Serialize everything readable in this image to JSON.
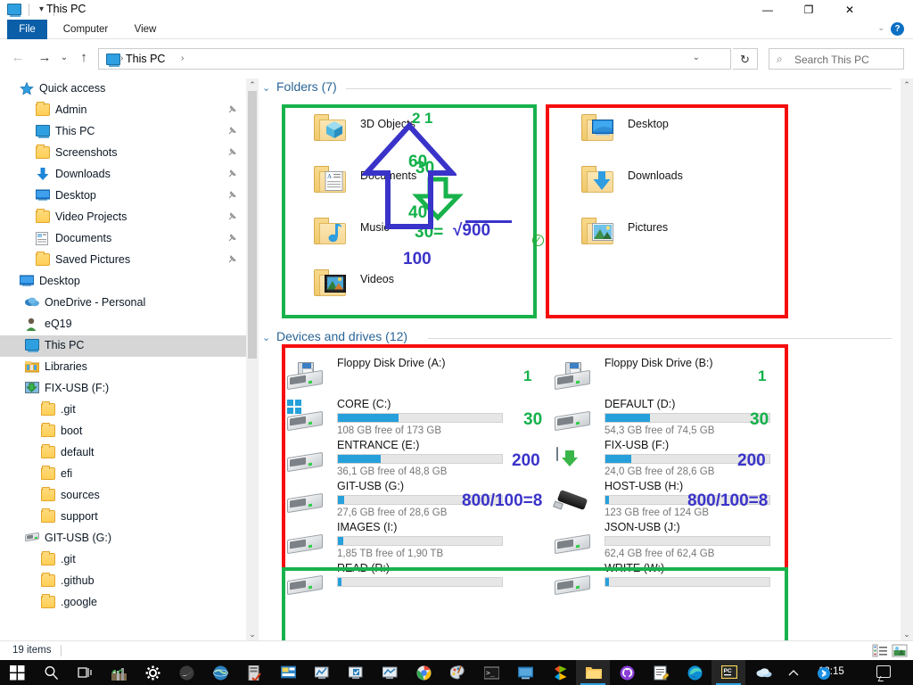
{
  "window": {
    "title": "This PC",
    "icon": "this-pc-icon",
    "quick_access_caret": "▾",
    "minimize": "—",
    "maximize": "❐",
    "close": "✕",
    "help": "?",
    "ribbon_caret": "⌄"
  },
  "ribbon": {
    "tabs": [
      {
        "label": "File"
      },
      {
        "label": "Computer"
      },
      {
        "label": "View"
      }
    ]
  },
  "address": {
    "back": "←",
    "forward": "→",
    "recent": "⌄",
    "up": "↑",
    "crumbs": [
      "This PC"
    ],
    "separator": "›",
    "dropdown_caret": "⌄",
    "refresh": "↻"
  },
  "search": {
    "placeholder": "Search This PC",
    "icon": "search-icon"
  },
  "sidebar": {
    "items": [
      {
        "label": "Quick access",
        "icon": "star-icon",
        "indent": 22,
        "pin": false,
        "selected": false
      },
      {
        "label": "Admin",
        "icon": "folder-icon",
        "indent": 40,
        "pin": true,
        "selected": false
      },
      {
        "label": "This PC",
        "icon": "monitor-icon",
        "indent": 40,
        "pin": true,
        "selected": false
      },
      {
        "label": "Screenshots",
        "icon": "folder-icon",
        "indent": 40,
        "pin": true,
        "selected": false
      },
      {
        "label": "Downloads",
        "icon": "download-icon",
        "indent": 40,
        "pin": true,
        "selected": false
      },
      {
        "label": "Desktop",
        "icon": "desktop-icon",
        "indent": 40,
        "pin": true,
        "selected": false
      },
      {
        "label": "Video Projects",
        "icon": "folder-icon",
        "indent": 40,
        "pin": true,
        "selected": false
      },
      {
        "label": "Documents",
        "icon": "document-icon",
        "indent": 40,
        "pin": true,
        "selected": false
      },
      {
        "label": "Saved Pictures",
        "icon": "folder-icon",
        "indent": 40,
        "pin": true,
        "selected": false
      },
      {
        "label": "Desktop",
        "icon": "desktop-icon",
        "indent": 22,
        "pin": false,
        "selected": false
      },
      {
        "label": "OneDrive - Personal",
        "icon": "cloud-icon",
        "indent": 28,
        "pin": false,
        "selected": false
      },
      {
        "label": "eQ19",
        "icon": "user-icon",
        "indent": 28,
        "pin": false,
        "selected": false
      },
      {
        "label": "This PC",
        "icon": "monitor-icon",
        "indent": 28,
        "pin": false,
        "selected": true
      },
      {
        "label": "Libraries",
        "icon": "libraries-icon",
        "indent": 28,
        "pin": false,
        "selected": false
      },
      {
        "label": "FIX-USB (F:)",
        "icon": "green-arrow-drive-icon",
        "indent": 28,
        "pin": false,
        "selected": false
      },
      {
        "label": ".git",
        "icon": "folder-icon",
        "indent": 46,
        "pin": false,
        "selected": false
      },
      {
        "label": "boot",
        "icon": "folder-icon",
        "indent": 46,
        "pin": false,
        "selected": false
      },
      {
        "label": "default",
        "icon": "folder-icon",
        "indent": 46,
        "pin": false,
        "selected": false
      },
      {
        "label": "efi",
        "icon": "folder-icon",
        "indent": 46,
        "pin": false,
        "selected": false
      },
      {
        "label": "sources",
        "icon": "folder-icon",
        "indent": 46,
        "pin": false,
        "selected": false
      },
      {
        "label": "support",
        "icon": "folder-icon",
        "indent": 46,
        "pin": false,
        "selected": false
      },
      {
        "label": "GIT-USB (G:)",
        "icon": "hdd-icon",
        "indent": 28,
        "pin": false,
        "selected": false
      },
      {
        "label": ".git",
        "icon": "folder-icon",
        "indent": 46,
        "pin": false,
        "selected": false
      },
      {
        "label": ".github",
        "icon": "folder-icon",
        "indent": 46,
        "pin": false,
        "selected": false
      },
      {
        "label": ".google",
        "icon": "folder-icon",
        "indent": 46,
        "pin": false,
        "selected": false
      }
    ],
    "pin_glyph": "📌"
  },
  "groups": {
    "folders": {
      "label": "Folders (7)",
      "chevron": "⌄"
    },
    "drives": {
      "label": "Devices and drives (12)",
      "chevron": "⌄"
    }
  },
  "folders": [
    {
      "name": "3D Objects",
      "icon": "3d-objects-folder-icon",
      "col": 0,
      "row": 0
    },
    {
      "name": "Desktop",
      "icon": "desktop-folder-icon",
      "col": 1,
      "row": 0
    },
    {
      "name": "Documents",
      "icon": "documents-folder-icon",
      "col": 0,
      "row": 1
    },
    {
      "name": "Downloads",
      "icon": "downloads-folder-icon",
      "col": 1,
      "row": 1
    },
    {
      "name": "Music",
      "icon": "music-folder-icon",
      "col": 0,
      "row": 2
    },
    {
      "name": "Pictures",
      "icon": "pictures-folder-icon",
      "col": 1,
      "row": 2
    },
    {
      "name": "Videos",
      "icon": "videos-folder-icon",
      "col": 0,
      "row": 3
    }
  ],
  "drives": [
    {
      "name": "Floppy Disk Drive (A:)",
      "icon": "floppy-drive-icon",
      "bar": false,
      "fill": 0,
      "free": "",
      "col": 0,
      "row": 0
    },
    {
      "name": "Floppy Disk Drive (B:)",
      "icon": "floppy-drive-icon",
      "bar": false,
      "fill": 0,
      "free": "",
      "col": 1,
      "row": 0
    },
    {
      "name": "CORE (C:)",
      "icon": "windows-drive-icon",
      "bar": true,
      "fill": 37,
      "free": "108 GB free of 173 GB",
      "col": 0,
      "row": 1
    },
    {
      "name": "DEFAULT (D:)",
      "icon": "hdd-icon",
      "bar": true,
      "fill": 27,
      "free": "54,3 GB free of 74,5 GB",
      "col": 1,
      "row": 1
    },
    {
      "name": "ENTRANCE (E:)",
      "icon": "hdd-icon",
      "bar": true,
      "fill": 26,
      "free": "36,1 GB free of 48,8 GB",
      "col": 0,
      "row": 2
    },
    {
      "name": "FIX-USB (F:)",
      "icon": "green-arrow-drive-icon",
      "bar": true,
      "fill": 16,
      "free": "24,0 GB free of 28,6 GB",
      "col": 1,
      "row": 2
    },
    {
      "name": "GIT-USB (G:)",
      "icon": "hdd-icon",
      "bar": true,
      "fill": 4,
      "free": "27,6 GB free of 28,6 GB",
      "col": 0,
      "row": 3
    },
    {
      "name": "HOST-USB (H:)",
      "icon": "usb-stick-icon",
      "bar": true,
      "fill": 2,
      "free": "123 GB free of 124 GB",
      "col": 1,
      "row": 3
    },
    {
      "name": "IMAGES (I:)",
      "icon": "hdd-icon",
      "bar": true,
      "fill": 3,
      "free": "1,85 TB free of 1,90 TB",
      "col": 0,
      "row": 4
    },
    {
      "name": "JSON-USB (J:)",
      "icon": "hdd-icon",
      "bar": true,
      "fill": 0,
      "free": "62,4 GB free of 62,4 GB",
      "col": 1,
      "row": 4
    },
    {
      "name": "READ (R:)",
      "icon": "hdd-icon",
      "bar": true,
      "fill": 2,
      "free": "",
      "col": 0,
      "row": 5
    },
    {
      "name": "WRITE (W:)",
      "icon": "hdd-icon",
      "bar": true,
      "fill": 2,
      "free": "",
      "col": 1,
      "row": 5
    }
  ],
  "annotations": {
    "colors": {
      "green": "#18b24c",
      "red": "#f60d0d",
      "blue": "#3a33c9",
      "green_text": "#13b14a"
    },
    "folders_green_box": {
      "values": [
        "1",
        "30",
        "30=",
        "√900"
      ]
    },
    "folders_red_box": {
      "values": [
        "2",
        "60",
        "40",
        "100"
      ]
    },
    "drives_numbers": {
      "left": [
        "1",
        "30",
        "200",
        "800/100=8"
      ],
      "right": [
        "1",
        "30",
        "200",
        "800/100=8"
      ]
    },
    "check_icon": "✓"
  },
  "statusbar": {
    "items_count": "19 items",
    "view_details": "details-view-icon",
    "view_icons": "large-icons-view-icon"
  },
  "taskbar": {
    "time": "13:15",
    "left_items": [
      {
        "name": "start-button",
        "glyph": "start"
      },
      {
        "name": "search-button",
        "glyph": "search"
      },
      {
        "name": "task-view-button",
        "glyph": "taskview"
      },
      {
        "name": "app-factory",
        "glyph": "factory"
      },
      {
        "name": "app-settings",
        "glyph": "gear"
      },
      {
        "name": "app-moon",
        "glyph": "moon"
      },
      {
        "name": "app-globe",
        "glyph": "globe"
      },
      {
        "name": "app-server",
        "glyph": "server"
      },
      {
        "name": "app-presentation",
        "glyph": "present"
      },
      {
        "name": "app-monitor-chart",
        "glyph": "monchart"
      },
      {
        "name": "app-monitor-check",
        "glyph": "moncheck"
      },
      {
        "name": "app-monitor-blue",
        "glyph": "monblue"
      },
      {
        "name": "app-chrome",
        "glyph": "chrome"
      },
      {
        "name": "app-paint",
        "glyph": "paint"
      },
      {
        "name": "app-terminal",
        "glyph": "terminal"
      },
      {
        "name": "app-remote-desktop",
        "glyph": "remote"
      },
      {
        "name": "app-visualstudio",
        "glyph": "vs"
      },
      {
        "name": "app-file-explorer",
        "glyph": "explorer",
        "active": true
      },
      {
        "name": "app-github",
        "glyph": "github"
      },
      {
        "name": "app-notepad",
        "glyph": "notepad"
      },
      {
        "name": "app-edge",
        "glyph": "edge"
      },
      {
        "name": "app-pc-label",
        "glyph": "pc",
        "active": true
      }
    ],
    "tray": [
      {
        "name": "onedrive-tray-icon",
        "glyph": "cloud"
      },
      {
        "name": "show-hidden-icons",
        "glyph": "chevron-up"
      },
      {
        "name": "bluetooth-tray-icon",
        "glyph": "bt"
      }
    ]
  }
}
